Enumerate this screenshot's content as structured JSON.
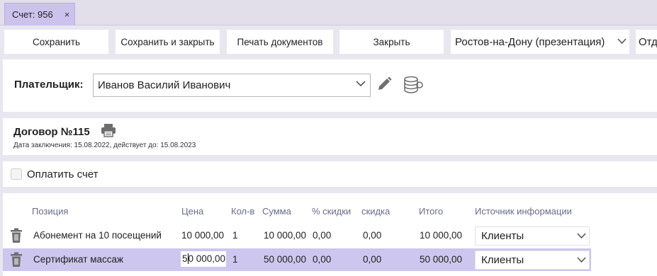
{
  "tab": {
    "title": "Счет: 956",
    "close": "×"
  },
  "toolbar": {
    "save": "Сохранить",
    "save_close": "Сохранить и закрыть",
    "print_docs": "Печать документов",
    "close": "Закрыть",
    "branch": "Ростов-на-Дону (презентация)",
    "next": "Отд"
  },
  "payer": {
    "label": "Плательщик:",
    "value": "Иванов Василий Иванович"
  },
  "contract": {
    "title": "Договор №115",
    "subtitle": "Дата заключения: 15.08.2022, действует до: 15.08.2023"
  },
  "pay": {
    "label": "Оплатить счет",
    "checked": false
  },
  "table": {
    "headers": [
      "Позиция",
      "Цена",
      "Кол-в",
      "Сумма",
      "% скидки",
      "скидка",
      "Итого",
      "Источник информации"
    ],
    "rows": [
      {
        "name": "Абонемент на 10 посещений",
        "price": "10 000,00",
        "qty": "1",
        "sum": "10 000,00",
        "pct": "0,00",
        "disc": "0,00",
        "total": "10 000,00",
        "source": "Клиенты",
        "selected": false
      },
      {
        "name": "Сертификат массаж",
        "price_a": "5",
        "price_b": "0 000,00",
        "qty": "1",
        "sum": "50 000,00",
        "pct": "0,00",
        "disc": "0,00",
        "total": "50 000,00",
        "source": "Клиенты",
        "selected": true
      }
    ]
  },
  "icons": {
    "edit": "pencil-icon",
    "db": "database-icon",
    "print": "printer-icon",
    "delete": "trash-icon",
    "dropdown": "chevron-down-icon"
  }
}
